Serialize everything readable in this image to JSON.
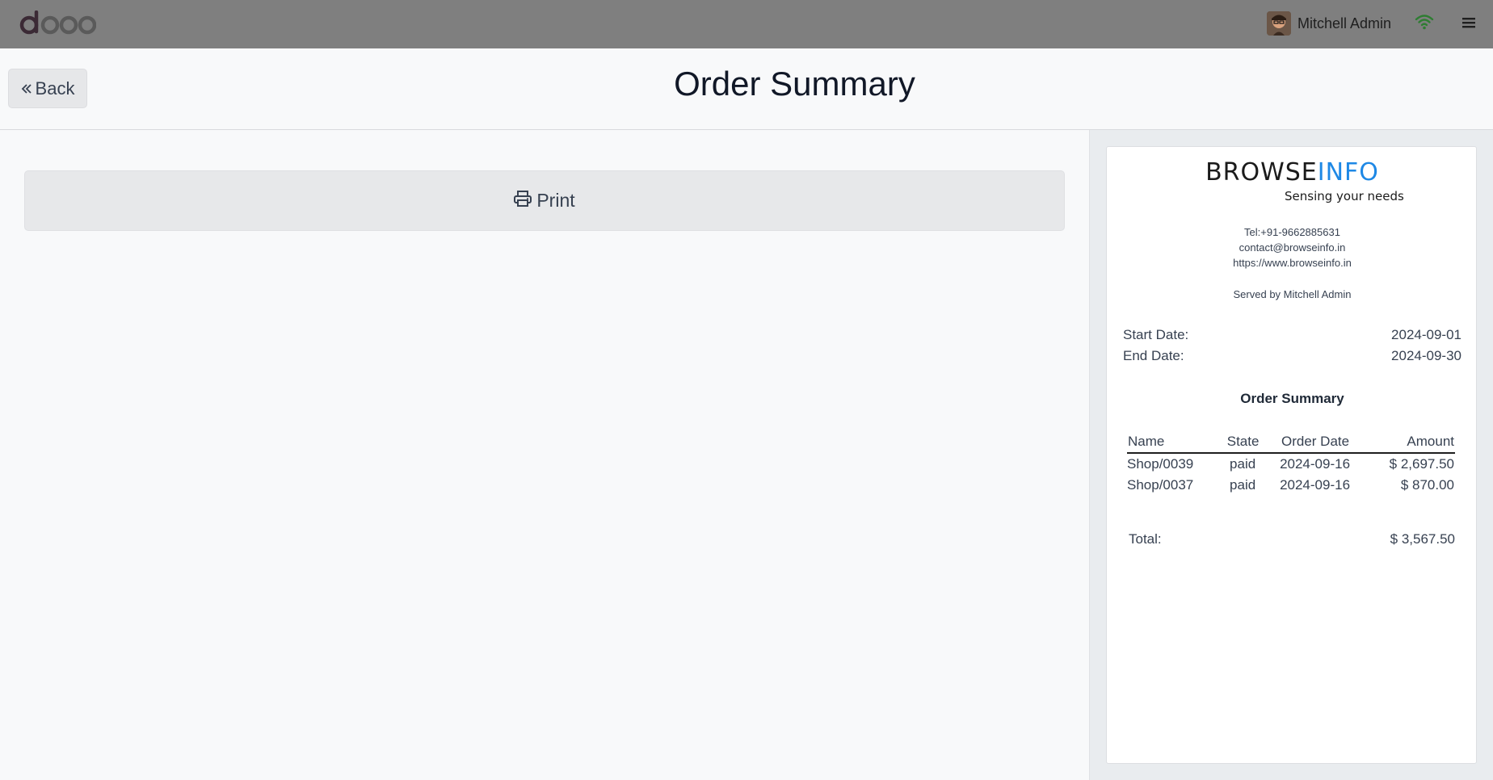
{
  "navbar": {
    "logo_text": "odoo",
    "user_name": "Mitchell Admin",
    "icons": [
      "odoo-logo",
      "avatar",
      "wifi-icon",
      "hamburger-menu-icon"
    ],
    "colors": {
      "bar": "#7f7f7f",
      "wifi": "#2e7d32"
    }
  },
  "header": {
    "back_label": "Back",
    "title": "Order Summary"
  },
  "left": {
    "print_label": "Print"
  },
  "receipt": {
    "brand_part1": "BROWSE",
    "brand_part2": "INFO",
    "tagline": "Sensing your needs",
    "tel": "Tel:+91-9662885631",
    "email": "contact@browseinfo.in",
    "website": "https://www.browseinfo.in",
    "served_by": "Served by Mitchell Admin",
    "start_label": "Start Date:",
    "start_value": "2024-09-01",
    "end_label": "End Date:",
    "end_value": "2024-09-30",
    "summary_title": "Order Summary",
    "columns": [
      "Name",
      "State",
      "Order Date",
      "Amount"
    ],
    "orders": [
      {
        "name": "Shop/0039",
        "state": "paid",
        "date": "2024-09-16",
        "amount": "$ 2,697.50"
      },
      {
        "name": "Shop/0037",
        "state": "paid",
        "date": "2024-09-16",
        "amount": "$ 870.00"
      }
    ],
    "total_label": "Total:",
    "total_value": "$ 3,567.50"
  }
}
